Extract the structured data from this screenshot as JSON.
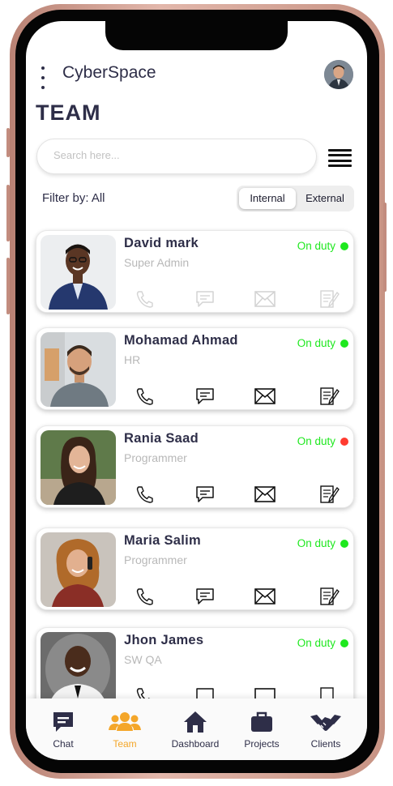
{
  "app": {
    "name": "CyberSpace"
  },
  "page": {
    "title": "TEAM"
  },
  "search": {
    "placeholder": "Search here..."
  },
  "filter": {
    "label": "Filter by: All",
    "options": [
      "Internal",
      "External"
    ],
    "selected": "Internal"
  },
  "members": [
    {
      "name": "David mark",
      "role": "Super Admin",
      "status": "On duty",
      "dot_color": "#1ee81e"
    },
    {
      "name": "Mohamad Ahmad",
      "role": "HR",
      "status": "On duty",
      "dot_color": "#1ee81e"
    },
    {
      "name": "Rania Saad",
      "role": "Programmer",
      "status": "On duty",
      "dot_color": "#ff3b30"
    },
    {
      "name": "Maria Salim",
      "role": "Programmer",
      "status": "On duty",
      "dot_color": "#1ee81e"
    },
    {
      "name": "Jhon James",
      "role": "SW QA",
      "status": "On duty",
      "dot_color": "#1ee81e"
    }
  ],
  "tabs": [
    {
      "label": "Chat",
      "icon": "chat-icon"
    },
    {
      "label": "Team",
      "icon": "team-icon",
      "active": true
    },
    {
      "label": "Dashboard",
      "icon": "home-icon"
    },
    {
      "label": "Projects",
      "icon": "briefcase-icon"
    },
    {
      "label": "Clients",
      "icon": "handshake-icon"
    }
  ],
  "colors": {
    "primary": "#2e2e48",
    "accent": "#f4a629",
    "on_duty": "#1ee81e",
    "alert": "#ff3b30"
  }
}
